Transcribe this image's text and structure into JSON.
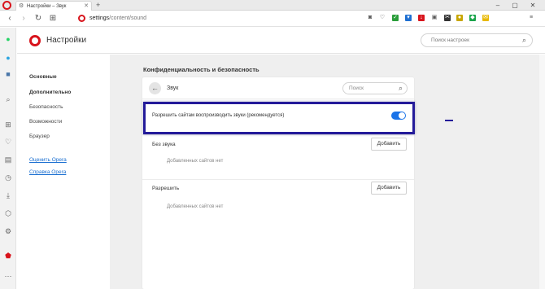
{
  "tab": {
    "icon": "gear-icon",
    "title": "Настройки – Звук",
    "close": "✕"
  },
  "newtab": "+",
  "window_controls": {
    "minimize": "–",
    "maximize": "▢",
    "close": "✕"
  },
  "nav": {
    "back": "‹",
    "forward": "›",
    "reload": "↻",
    "speed_dial": "⊞"
  },
  "address": {
    "host": "settings",
    "path": "/content/sound"
  },
  "extensions": [
    "camera-icon",
    "heart-icon",
    "shield-icon",
    "vpn-icon",
    "download-icon",
    "lock-icon",
    "scissors-icon",
    "crypto-icon",
    "extension-icon",
    "message-icon",
    "menu-icon"
  ],
  "sidebar_icons": [
    "whatsapp-icon",
    "telegram-icon",
    "vk-icon",
    "search-icon",
    "speed-dial-icon",
    "heart-icon",
    "news-icon",
    "history-icon",
    "download-icon",
    "box-icon",
    "settings-icon",
    "shield-icon",
    "more-icon"
  ],
  "header": {
    "title": "Настройки",
    "search_placeholder": "Поиск настроек"
  },
  "settings_nav": {
    "basic": "Основные",
    "advanced": "Дополнительно",
    "items": [
      "Безопасность",
      "Возможности",
      "Браузер"
    ],
    "links": [
      "Оценить Opera",
      "Справка Opera"
    ]
  },
  "main": {
    "section_title": "Конфиденциальность и безопасность",
    "card_title": "Звук",
    "card_search_placeholder": "Поиск",
    "toggle_label": "Разрешить сайтам воспроизводить звуки (рекомендуется)",
    "toggle_on": true,
    "mute_label": "Без звука",
    "mute_add": "Добавить",
    "mute_empty": "Добавленных сайтов нет",
    "allow_label": "Разрешить",
    "allow_add": "Добавить",
    "allow_empty": "Добавленных сайтов нет"
  },
  "colors": {
    "accent": "#1a73e8",
    "opera_red": "#d8141c",
    "highlight": "#241b9a",
    "link": "#1a6fd1"
  }
}
